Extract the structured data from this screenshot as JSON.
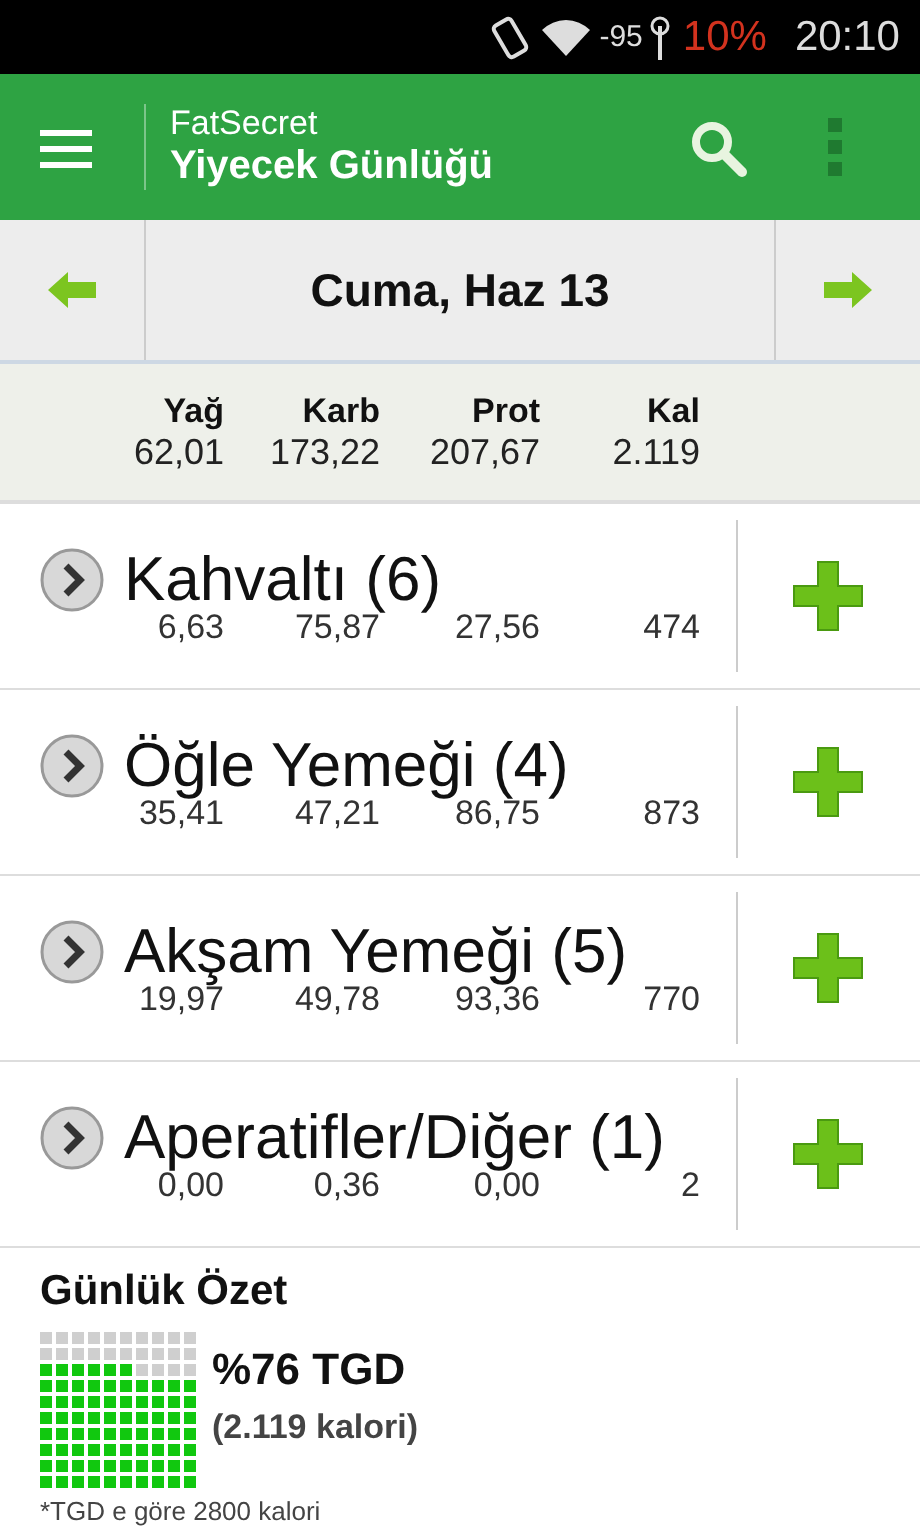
{
  "status_bar": {
    "signal_reading": "-95",
    "battery": "10%",
    "time": "20:10"
  },
  "app_bar": {
    "app_name": "FatSecret",
    "title": "Yiyecek Günlüğü"
  },
  "date_nav": {
    "date": "Cuma, Haz 13"
  },
  "totals": {
    "columns": [
      "Yağ",
      "Karb",
      "Prot",
      "Kal"
    ],
    "values": [
      "62,01",
      "173,22",
      "207,67",
      "2.119"
    ]
  },
  "meals": [
    {
      "name": "Kahvaltı (6)",
      "values": [
        "6,63",
        "75,87",
        "27,56",
        "474"
      ]
    },
    {
      "name": "Öğle Yemeği (4)",
      "values": [
        "35,41",
        "47,21",
        "86,75",
        "873"
      ]
    },
    {
      "name": "Akşam Yemeği (5)",
      "values": [
        "19,97",
        "49,78",
        "93,36",
        "770"
      ]
    },
    {
      "name": "Aperatifler/Diğer (1)",
      "values": [
        "0,00",
        "0,36",
        "0,00",
        "2"
      ]
    }
  ],
  "summary": {
    "title": "Günlük Özet",
    "percent": "%76 TGD",
    "calories": "(2.119 kalori)",
    "footnote": "*TGD e göre 2800 kalori"
  }
}
